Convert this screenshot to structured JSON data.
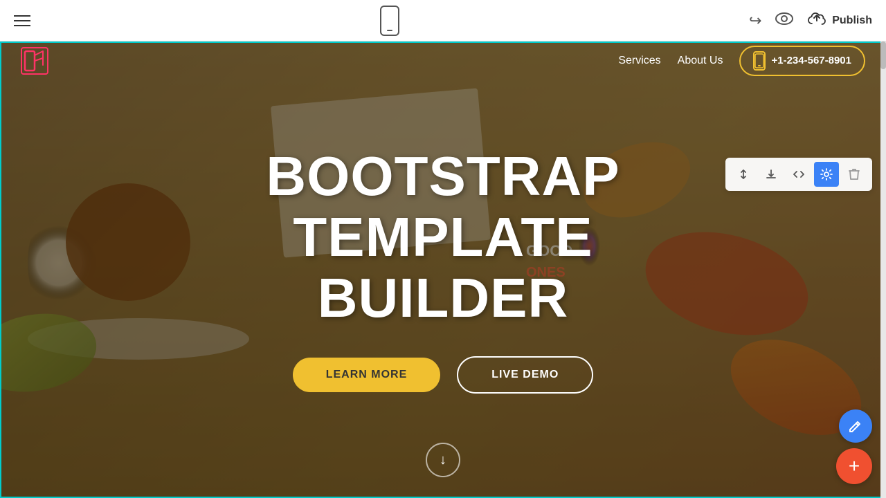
{
  "toolbar": {
    "publish_label": "Publish",
    "hamburger_label": "Menu",
    "undo_icon": "↩",
    "eye_icon": "👁",
    "cloud_icon": "☁"
  },
  "nav": {
    "services_label": "Services",
    "about_label": "About Us",
    "phone_number": "+1-234-567-8901"
  },
  "hero": {
    "title_line1": "BOOTSTRAP",
    "title_line2": "TEMPLATE BUILDER",
    "learn_more_label": "LEARN MORE",
    "live_demo_label": "LIVE DEMO",
    "scroll_down_icon": "↓"
  },
  "section_tools": {
    "sort_icon": "⇅",
    "download_icon": "↓",
    "code_icon": "</>",
    "settings_icon": "⚙",
    "delete_icon": "🗑"
  },
  "fabs": {
    "edit_icon": "✏",
    "add_icon": "+"
  }
}
